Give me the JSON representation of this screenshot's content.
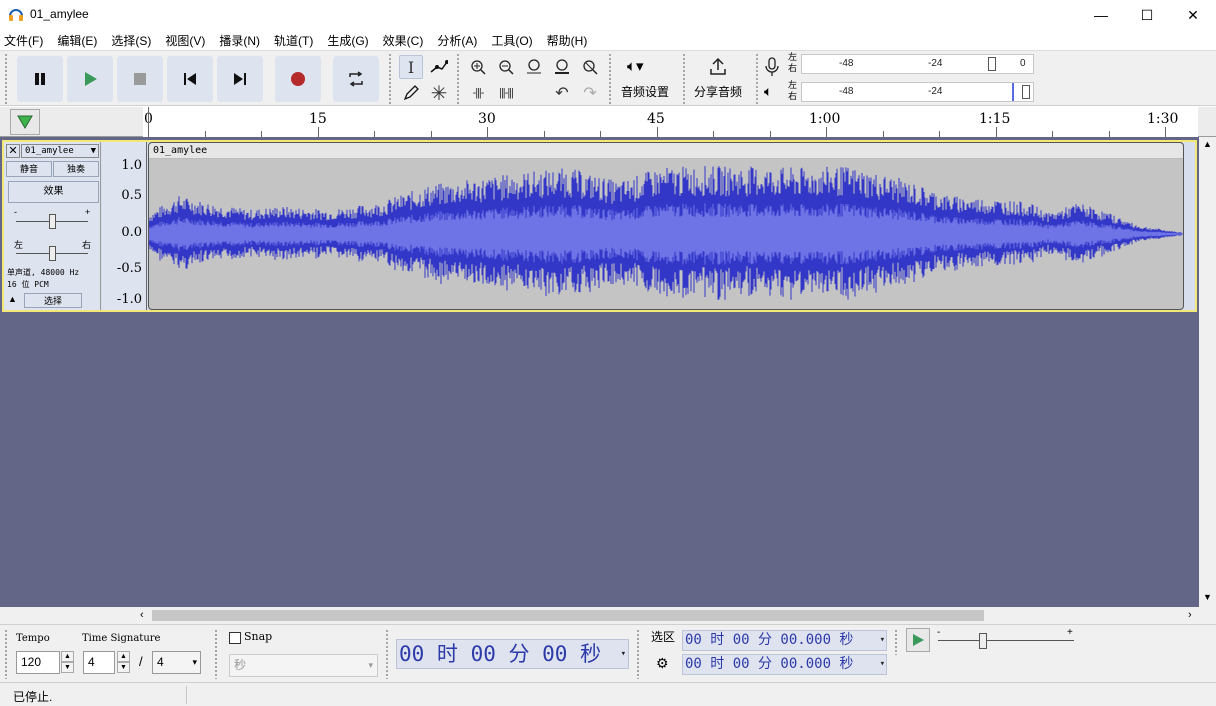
{
  "window": {
    "title": "01_amylee",
    "controls": {
      "minimize": "—",
      "maximize": "☐",
      "close": "✕"
    }
  },
  "menu": [
    "文件(F)",
    "编辑(E)",
    "选择(S)",
    "视图(V)",
    "播录(N)",
    "轨道(T)",
    "生成(G)",
    "效果(C)",
    "分析(A)",
    "工具(O)",
    "帮助(H)"
  ],
  "toolbar": {
    "audio_setup_label": "音频设置",
    "share_audio_label": "分享音频",
    "meter": {
      "channel_left": "左",
      "channel_right": "右",
      "record_ticks": [
        "-48",
        "-24",
        "0"
      ],
      "play_ticks": [
        "-48",
        "-24"
      ]
    }
  },
  "timeline": {
    "labels": [
      "0",
      "15",
      "30",
      "45",
      "1:00",
      "1:15",
      "1:30"
    ]
  },
  "track": {
    "name": "01_amylee",
    "clip_name": "01_amylee",
    "mute_label": "静音",
    "solo_label": "独奏",
    "effects_label": "效果",
    "gain_minus": "-",
    "gain_plus": "+",
    "pan_left": "左",
    "pan_right": "右",
    "format_line1": "单声道, 48000 Hz",
    "format_line2": "16 位 PCM",
    "select_label": "选择",
    "scale": [
      "1.0",
      "0.5",
      "0.0",
      "-0.5",
      "-1.0"
    ]
  },
  "bottom": {
    "tempo_label": "Tempo",
    "tempo_value": "120",
    "timesig_label": "Time Signature",
    "timesig_num": "4",
    "timesig_sep": "/",
    "timesig_den": "4",
    "snap_label": "Snap",
    "snap_unit": "秒",
    "time_display": "00 时 00 分 00 秒",
    "selection_label": "选区",
    "sel_start": "00 时 00 分 00.000 秒",
    "sel_end": "00 时 00 分 00.000 秒",
    "speed_minus": "-",
    "speed_plus": "+"
  },
  "status": {
    "text": "已停止."
  },
  "colors": {
    "waveform": "#3237c8",
    "waveform_rms": "#6e73e6",
    "track_border": "#f1e878",
    "track_bg": "#636686",
    "record": "#b52a2a",
    "play": "#3a9a5a"
  }
}
